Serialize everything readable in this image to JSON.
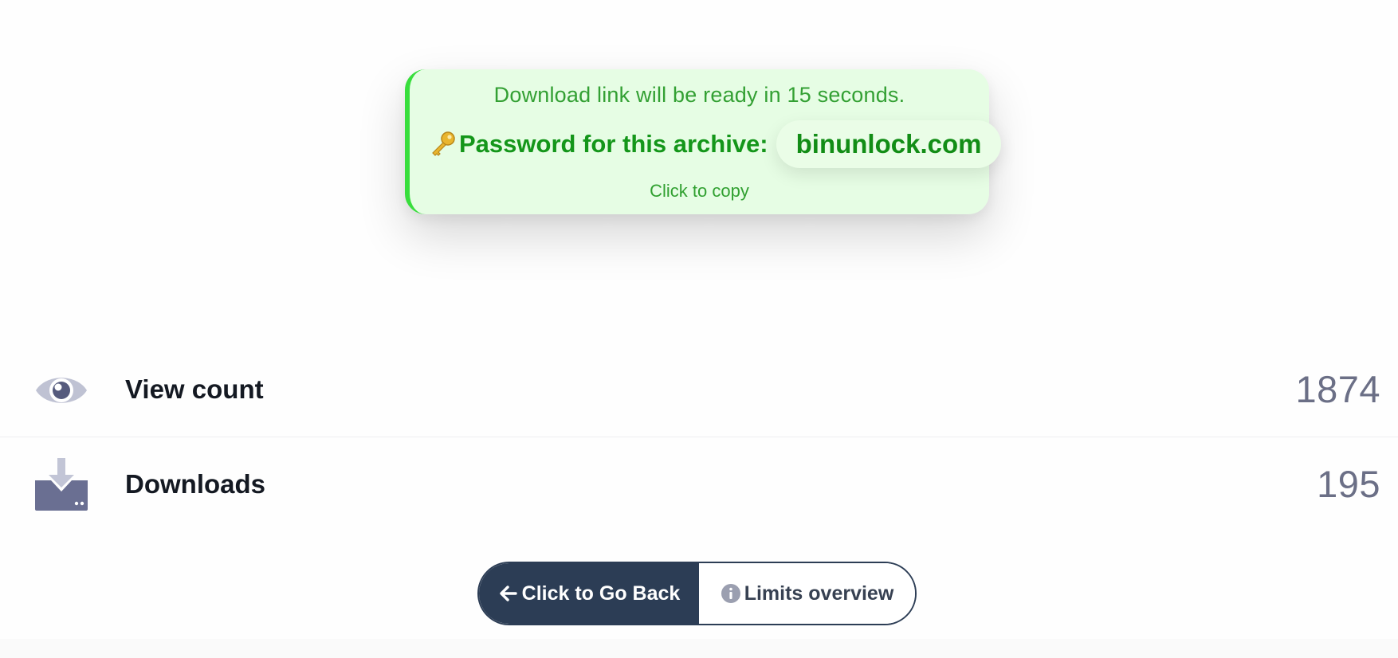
{
  "notice": {
    "message": "Download link will be ready in 15 seconds.",
    "password_label": "Password for this archive:",
    "password_value": "binunlock.com",
    "copy_hint": "Click to copy",
    "key_icon": "key-icon",
    "accent_color": "#38de3c",
    "background_color": "#e6fde4"
  },
  "stats": [
    {
      "label": "View count",
      "value": "1874",
      "icon": "eye-icon"
    },
    {
      "label": "Downloads",
      "value": "195",
      "icon": "download-icon"
    }
  ],
  "actions": {
    "back_label": "Click to Go Back",
    "back_icon": "arrow-left-icon",
    "limits_label": "Limits overview",
    "limits_icon": "info-icon",
    "primary_color": "#2c3d55"
  }
}
